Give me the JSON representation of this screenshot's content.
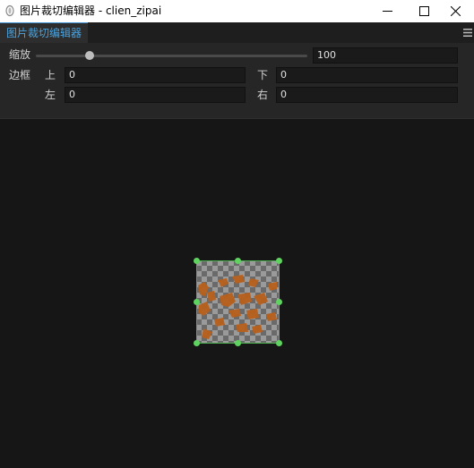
{
  "window": {
    "title": "图片裁切编辑器 - clien_zipai",
    "controls": {
      "minimize": "─",
      "maximize": "☐",
      "close": "✕"
    }
  },
  "tab": {
    "label": "图片裁切编辑器"
  },
  "zoom": {
    "label": "缩放",
    "value": "100",
    "slider_fraction": 0.18
  },
  "border": {
    "label": "边框",
    "top_label": "上",
    "top_value": "0",
    "bottom_label": "下",
    "bottom_value": "0",
    "left_label": "左",
    "left_value": "0",
    "right_label": "右",
    "right_value": "0"
  },
  "colors": {
    "accent": "#4aa3df",
    "handle": "#5fd35f",
    "crop_border": "#4caf50",
    "image_paint": "#b8601c"
  },
  "icons": {
    "app": "app-icon",
    "menu": "hamburger-menu-icon"
  }
}
